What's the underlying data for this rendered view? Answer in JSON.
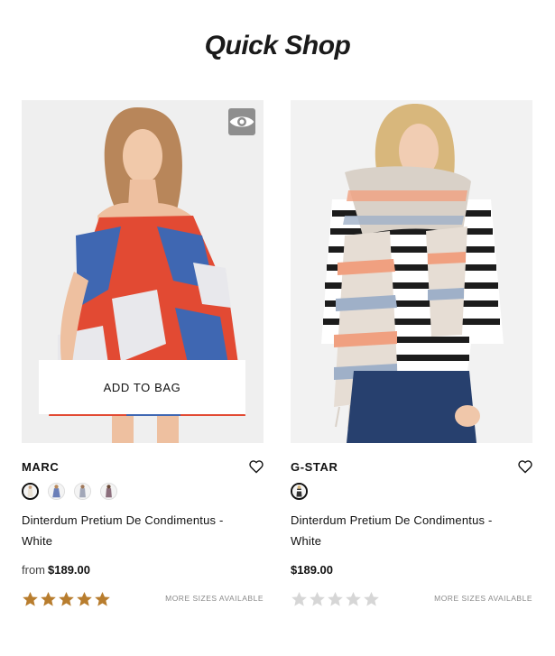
{
  "page": {
    "title": "Quick Shop"
  },
  "colors": {
    "star_filled": "#b87d2e",
    "star_empty": "#d6d6d6",
    "quickview_bg": "#8e8e8e"
  },
  "products": [
    {
      "brand": "MARC",
      "name": "Dinterdum Pretium De Condimentus - White",
      "price_prefix": "from",
      "price": "$189.00",
      "add_to_bag_label": "ADD TO BAG",
      "sizes_label": "MORE SIZES AVAILABLE",
      "rating": 5,
      "rating_max": 5,
      "swatch_count": 4,
      "icons": [
        "eye-icon",
        "heart-icon",
        "star-icon"
      ]
    },
    {
      "brand": "G-STAR",
      "name": "Dinterdum Pretium De Condimentus - White",
      "price_prefix": "",
      "price": "$189.00",
      "sizes_label": "MORE SIZES AVAILABLE",
      "rating": 0,
      "rating_max": 5,
      "swatch_count": 1,
      "icons": [
        "heart-icon",
        "star-icon"
      ]
    }
  ]
}
